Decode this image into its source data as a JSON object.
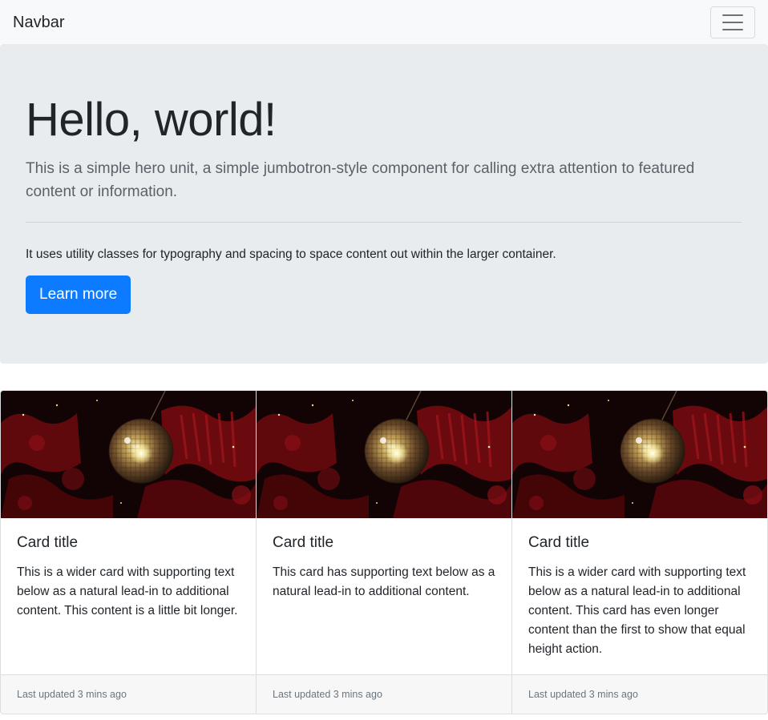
{
  "navbar": {
    "brand": "Navbar",
    "toggler_icon": "hamburger-menu-icon"
  },
  "jumbotron": {
    "heading": "Hello, world!",
    "lead": "This is a simple hero unit, a simple jumbotron-style component for calling extra attention to featured content or information.",
    "body": "It uses utility classes for typography and spacing to space content out within the larger container.",
    "button_label": "Learn more"
  },
  "colors": {
    "primary": "#0d7bff",
    "jumbotron_bg": "#e9ecef",
    "navbar_bg": "#f8f9fa",
    "footer_bg": "#f7f7f7"
  },
  "cards": [
    {
      "title": "Card title",
      "text": "This is a wider card with supporting text below as a natural lead-in to additional content. This content is a little bit longer.",
      "footer": "Last updated 3 mins ago"
    },
    {
      "title": "Card title",
      "text": "This card has supporting text below as a natural lead-in to additional content.",
      "footer": "Last updated 3 mins ago"
    },
    {
      "title": "Card title",
      "text": "This is a wider card with supporting text below as a natural lead-in to additional content. This card has even longer content than the first to show that equal height action.",
      "footer": "Last updated 3 mins ago"
    }
  ]
}
